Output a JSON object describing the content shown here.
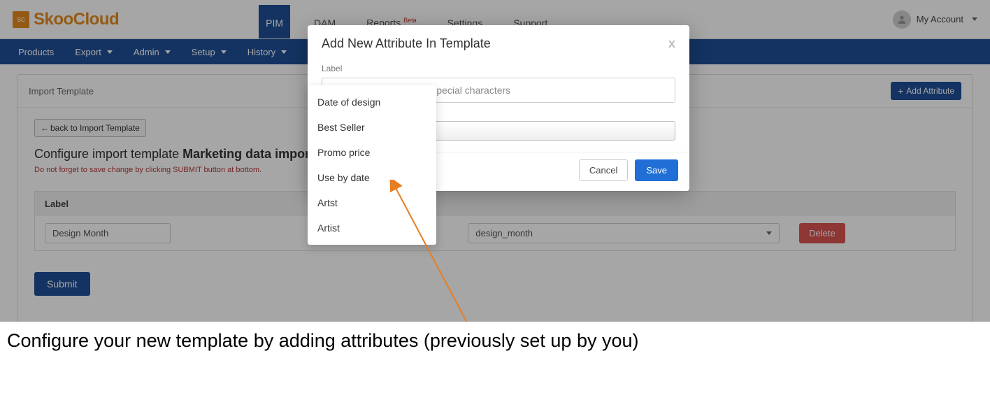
{
  "brand": {
    "badge": "sc",
    "name": "SkooCloud"
  },
  "topnav": {
    "items": [
      "PIM",
      "DAM",
      "Reports",
      "Settings",
      "Support"
    ],
    "beta_badge": "Beta",
    "active_index": 0
  },
  "account": {
    "label": "My Account"
  },
  "subnav": {
    "items": [
      "Products",
      "Export",
      "Admin",
      "Setup",
      "History"
    ]
  },
  "page": {
    "breadcrumb": "Import Template",
    "add_attr_label": "Add Attribute",
    "back_label": "back to Import Template",
    "configure_prefix": "Configure import template ",
    "template_name": "Marketing data import sp",
    "warning": "Do not forget to save change by clicking SUBMIT button at bottom.",
    "table": {
      "headers": {
        "label": "Label",
        "field": "",
        "action": ""
      },
      "rows": [
        {
          "label": "Design Month",
          "field": "design_month",
          "action": "Delete"
        }
      ]
    },
    "submit_label": "Submit"
  },
  "modal": {
    "title": "Add New Attribute In Template",
    "close": "x",
    "label_field_label": "Label",
    "label_placeholder": "Should not contain any special characters",
    "cancel": "Cancel",
    "save": "Save"
  },
  "autocomplete": {
    "items": [
      "Date of design",
      "Best Seller",
      "Promo price",
      "Use by date",
      "Artst",
      "Artist"
    ]
  },
  "caption": "Configure your new template by adding attributes (previously set up by you)"
}
